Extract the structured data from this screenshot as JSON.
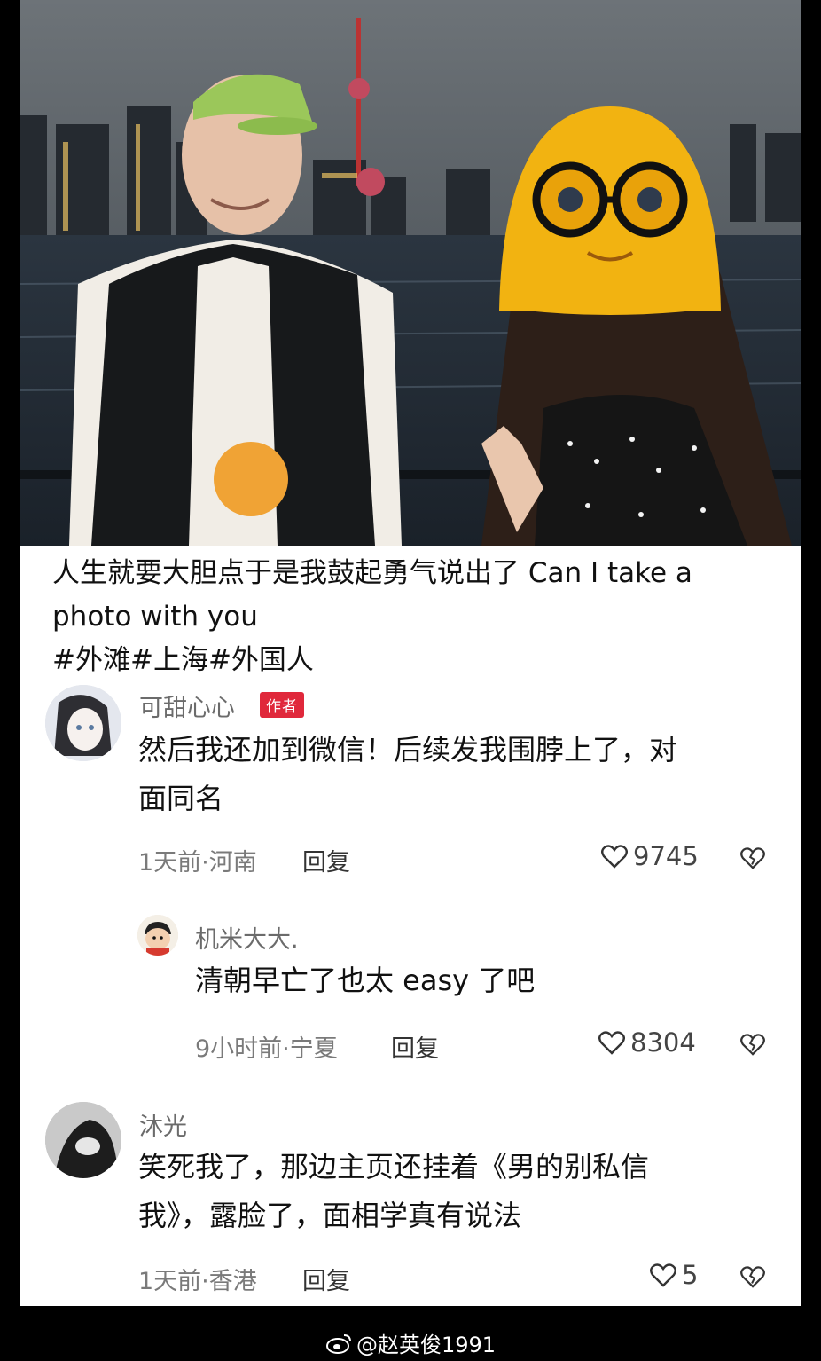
{
  "post": {
    "caption_line1": "人生就要大胆点于是我鼓起勇气说出了 Can I take a",
    "caption_line2": "photo with you",
    "tags": "#外滩#上海#外国人"
  },
  "comments": [
    {
      "name": "可甜心心",
      "badge": "作者",
      "text_line1": "然后我还加到微信！后续发我围脖上了，对",
      "text_line2": "面同名",
      "meta": "1天前·河南",
      "reply": "回复",
      "likes": "9745"
    },
    {
      "name": "机米大大.",
      "text_line1": "清朝早亡了也太 easy 了吧",
      "meta": "9小时前·宁夏",
      "reply": "回复",
      "likes": "8304"
    },
    {
      "name": "沐光",
      "text_line1": "笑死我了，那边主页还挂着《男的别私信",
      "text_line2": "我》，露脸了，面相学真有说法",
      "meta": "1天前·香港",
      "reply": "回复",
      "likes": "5"
    }
  ],
  "watermark": {
    "text": "@赵英俊1991",
    "icon": "weibo-icon"
  },
  "colors": {
    "badge": "#e0283b",
    "background": "#ffffff",
    "frame": "#000000"
  },
  "icons": {
    "like": "heart-outline-icon",
    "dislike": "broken-heart-icon"
  }
}
